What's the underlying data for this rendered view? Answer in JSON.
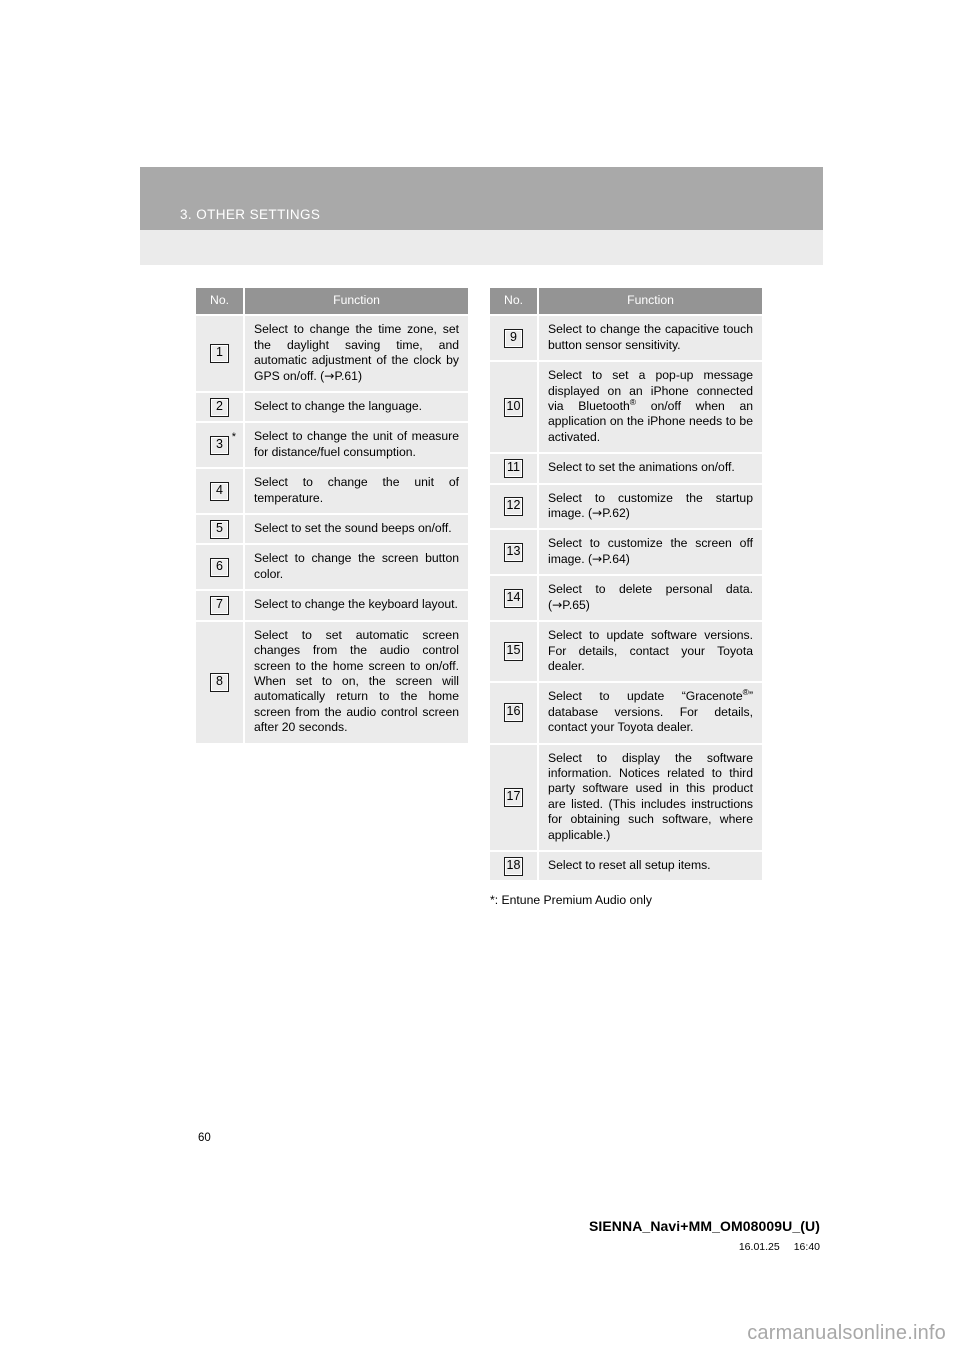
{
  "header": {
    "chapter_title": "3. OTHER SETTINGS",
    "band_color": "#a9a9a9",
    "subband_color": "#ebebeb"
  },
  "tables": {
    "columns": {
      "no": "No.",
      "function": "Function"
    },
    "left_rows": [
      {
        "no": "1",
        "star": "",
        "text": "Select to change the time zone, set the daylight saving time, and automatic adjustment of the clock by GPS on/off. (→P.61)"
      },
      {
        "no": "2",
        "star": "",
        "text": "Select to change the language."
      },
      {
        "no": "3",
        "star": "*",
        "text": "Select to change the unit of measure for distance/fuel consumption."
      },
      {
        "no": "4",
        "star": "",
        "text": "Select to change the unit of temperature."
      },
      {
        "no": "5",
        "star": "",
        "text": "Select to set the sound beeps on/off."
      },
      {
        "no": "6",
        "star": "",
        "text": "Select to change the screen button color."
      },
      {
        "no": "7",
        "star": "",
        "text": "Select to change the keyboard layout."
      },
      {
        "no": "8",
        "star": "",
        "text": "Select to set automatic screen changes from the audio control screen to the home screen to on/off. When set to on, the screen will automatically return to the home screen from the audio control screen after 20 seconds."
      }
    ],
    "right_rows": [
      {
        "no": "9",
        "text_html": "Select to change the capacitive touch button sensor sensitivity."
      },
      {
        "no": "10",
        "text_html": "Select to set a pop-up message displayed on an iPhone connected via Bluetooth<sup class=\"reg\">&reg;</sup> on/off when an application on the iPhone needs to be activated."
      },
      {
        "no": "11",
        "text_html": "Select to set the animations on/off."
      },
      {
        "no": "12",
        "text_html": "Select to customize the startup image. (&rarr;P.62)"
      },
      {
        "no": "13",
        "text_html": "Select to customize the screen off image. (&rarr;P.64)"
      },
      {
        "no": "14",
        "text_html": "Select to delete personal data. (&rarr;P.65)"
      },
      {
        "no": "15",
        "text_html": "Select to update software versions. For details, contact your Toyota dealer."
      },
      {
        "no": "16",
        "text_html": "Select to update &ldquo;Gracenote<sup class=\"reg\">&reg;</sup>&rdquo; database versions. For details, contact your Toyota dealer."
      },
      {
        "no": "17",
        "text_html": "Select to display the software information. Notices related to third party software used in this product are listed. (This includes instructions for obtaining such software, where applicable.)"
      },
      {
        "no": "18",
        "text_html": "Select to reset all setup items."
      }
    ],
    "footnote": "*: Entune Premium Audio only"
  },
  "page_number": "60",
  "footer": {
    "document_id": "SIENNA_Navi+MM_OM08009U_(U)",
    "date": "16.01.25",
    "time": "16:40"
  },
  "watermark": "carmanualsonline.info"
}
